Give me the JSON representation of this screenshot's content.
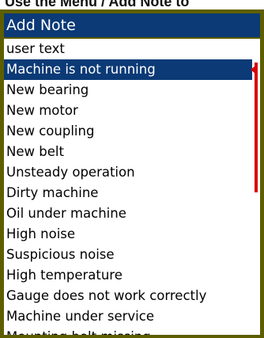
{
  "header_fragment": "Use the Menu / Add Note to",
  "dialog": {
    "title": "Add Note",
    "items": [
      "user text",
      "Machine is not running",
      "New bearing",
      "New motor",
      "New coupling",
      "New belt",
      "Unsteady operation",
      "Dirty machine",
      "Oil under machine",
      "High noise",
      "Suspicious noise",
      "High temperature",
      "Gauge does not work correctly",
      "Machine under service",
      "Mounting bolt missing"
    ],
    "selected_index": 1
  },
  "colors": {
    "title_bar": "#0b3a76",
    "selection": "#0b3a76",
    "frame": "#5e5e00",
    "scrollbar": "#d80000"
  }
}
